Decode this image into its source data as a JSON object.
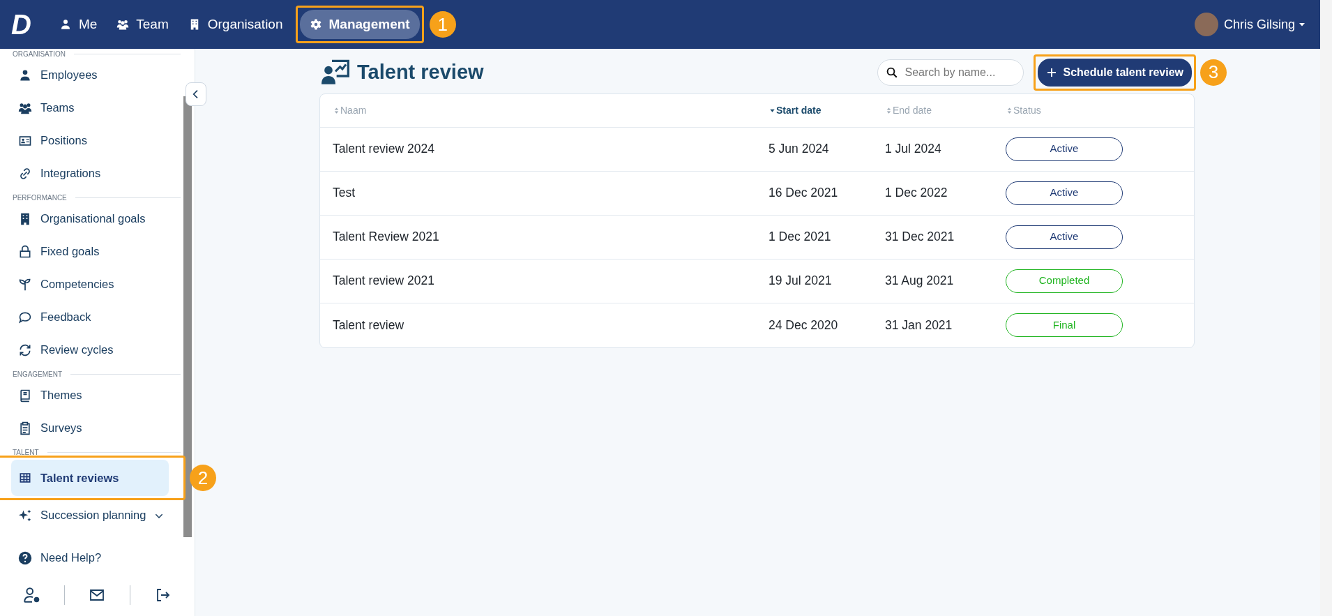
{
  "navbar": {
    "logo": "D",
    "items": [
      {
        "label": "Me",
        "selected": false
      },
      {
        "label": "Team",
        "selected": false
      },
      {
        "label": "Organisation",
        "selected": false
      },
      {
        "label": "Management",
        "selected": true,
        "callout": "1"
      }
    ],
    "user": {
      "name": "Chris Gilsing"
    }
  },
  "sidebar": {
    "sections": [
      {
        "title": "ORGANISATION",
        "items": [
          {
            "label": "Employees",
            "selected": false
          },
          {
            "label": "Teams",
            "selected": false
          },
          {
            "label": "Positions",
            "selected": false
          },
          {
            "label": "Integrations",
            "selected": false
          }
        ]
      },
      {
        "title": "PERFORMANCE",
        "items": [
          {
            "label": "Organisational goals",
            "selected": false
          },
          {
            "label": "Fixed goals",
            "selected": false
          },
          {
            "label": "Competencies",
            "selected": false
          },
          {
            "label": "Feedback",
            "selected": false
          },
          {
            "label": "Review cycles",
            "selected": false
          }
        ]
      },
      {
        "title": "ENGAGEMENT",
        "items": [
          {
            "label": "Themes",
            "selected": false
          },
          {
            "label": "Surveys",
            "selected": false
          }
        ]
      },
      {
        "title": "TALENT",
        "items": [
          {
            "label": "Talent reviews",
            "selected": true,
            "callout": "2"
          },
          {
            "label": "Succession planning",
            "selected": false,
            "expanded": false
          }
        ]
      }
    ],
    "help": "Need Help?"
  },
  "page": {
    "title": "Talent review",
    "search": {
      "placeholder": "Search by name..."
    },
    "button": {
      "label": "Schedule talent review",
      "callout": "3"
    }
  },
  "table": {
    "columns": [
      {
        "label": "Naam",
        "sorted": false
      },
      {
        "label": "Start date",
        "sorted": true
      },
      {
        "label": "End date",
        "sorted": false
      },
      {
        "label": "Status",
        "sorted": false
      }
    ],
    "rows": [
      {
        "name": "Talent review 2024",
        "start": "5 Jun 2024",
        "end": "1 Jul 2024",
        "status": {
          "label": "Active",
          "color": "#203b75"
        }
      },
      {
        "name": "Test",
        "start": "16 Dec 2021",
        "end": "1 Dec 2022",
        "status": {
          "label": "Active",
          "color": "#203b75"
        }
      },
      {
        "name": "Talent Review 2021",
        "start": "1 Dec 2021",
        "end": "31 Dec 2021",
        "status": {
          "label": "Active",
          "color": "#203b75"
        }
      },
      {
        "name": "Talent review 2021",
        "start": "19 Jul 2021",
        "end": "31 Aug 2021",
        "status": {
          "label": "Completed",
          "color": "#1fb41f"
        }
      },
      {
        "name": "Talent review",
        "start": "24 Dec 2020",
        "end": "31 Jan 2021",
        "status": {
          "label": "Final",
          "color": "#1fb41f"
        }
      }
    ]
  }
}
